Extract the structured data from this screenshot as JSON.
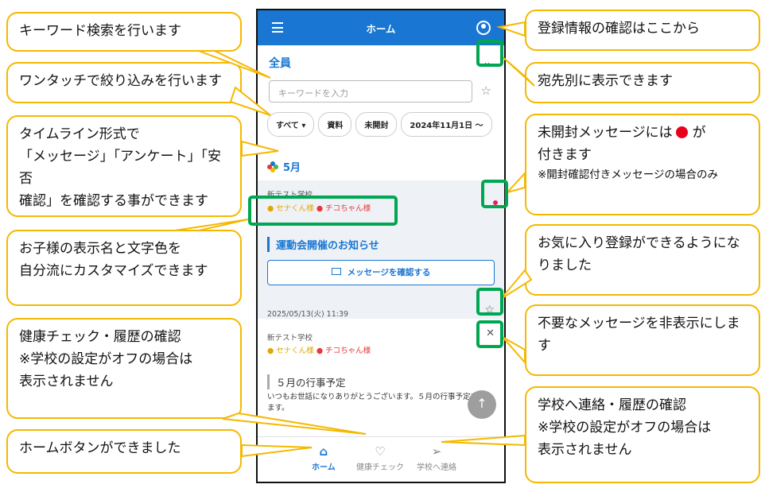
{
  "app": {
    "title": "ホーム",
    "group_label": "全員",
    "search_placeholder": "キーワードを入力",
    "chips": [
      "すべて",
      "資料",
      "未開封",
      "2024年11月1日 〜"
    ],
    "month": "5月",
    "cards": [
      {
        "school": "新テスト学校",
        "kid1": "● セナくん様",
        "kid2": "● チコちゃん様",
        "subject": "運動会開催のお知らせ",
        "button": "メッセージを確認する",
        "date": "2025/05/13(火) 11:39"
      },
      {
        "school": "新テスト学校",
        "kid1": "● セナくん様",
        "kid2": "● チコちゃん様",
        "subject": "５月の行事予定",
        "body": "いつもお世話になりありがとうございます。５月の行事予定を送ります。"
      }
    ],
    "nav": [
      {
        "label": "ホーム",
        "icon": "home-icon"
      },
      {
        "label": "健康チェック",
        "icon": "heart-icon"
      },
      {
        "label": "学校へ連絡",
        "icon": "send-icon"
      }
    ]
  },
  "callouts": {
    "keyword_search": "キーワード検索を行います",
    "one_touch_filter": "ワンタッチで絞り込みを行います",
    "timeline_line1": "タイムライン形式で",
    "timeline_line2": "「メッセージ」「アンケート」「安否",
    "timeline_line3": "確認」を確認する事ができます",
    "child_display_line1": "お子様の表示名と文字色を",
    "child_display_line2": "自分流にカスタマイズできます",
    "health_line1": "健康チェック・履歴の確認",
    "health_line2": "※学校の設定がオフの場合は",
    "health_line3": "表示されません",
    "home_button": "ホームボタンができました",
    "registration": "登録情報の確認はここから",
    "by_recipient": "宛先別に表示できます",
    "unread_line1_a": "未開封メッセージには",
    "unread_line1_b": "が",
    "unread_line2": "付きます",
    "unread_note": "※開封確認付きメッセージの場合のみ",
    "favorite_line1": "お気に入り登録ができるようにな",
    "favorite_line2": "りました",
    "hide_line1": "不要なメッセージを非表示にしま",
    "hide_line2": "す",
    "contact_line1": "学校へ連絡・履歴の確認",
    "contact_line2": "※学校の設定がオフの場合は",
    "contact_line3": "表示されません"
  },
  "colors": {
    "primary": "#1976d2",
    "callout_border": "#f5b800",
    "highlight": "#00a651",
    "unread_dot": "#e91e63"
  }
}
